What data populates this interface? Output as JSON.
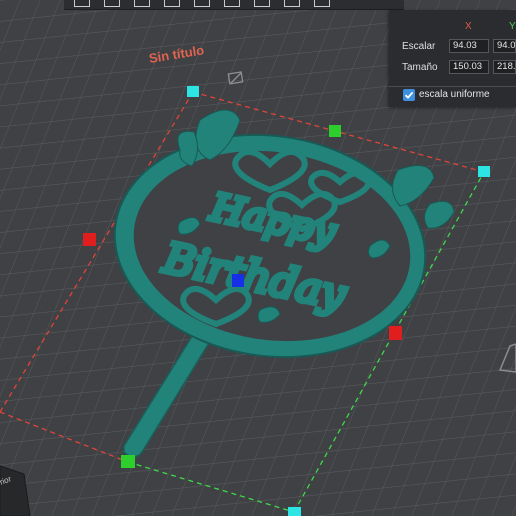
{
  "scene": {
    "title": "Sin título",
    "topper_text": [
      "Happy",
      "Birthday"
    ],
    "colors": {
      "grid_background": "#3f4144",
      "grid_line": "#575a5d",
      "model": "#22837b",
      "model_shadow": "#1a5f5a",
      "bbox_red": "#e0443a",
      "bbox_green": "#3fd94a",
      "handle_red": "#e01e1e",
      "handle_green": "#2ccf2c",
      "handle_blue": "#1630e8",
      "handle_cyan": "#2ee5e5",
      "title_color": "#e0644f"
    }
  },
  "scale_panel": {
    "axis_x": "X",
    "axis_y": "Y",
    "scale_label": "Escalar",
    "scale_x": "94.03",
    "scale_y": "94.0",
    "size_label": "Tamaño",
    "size_x": "150.03",
    "size_y": "218.",
    "uniform_label": "escala uniforme",
    "uniform_checked": true
  },
  "corner": {
    "label": "rior"
  }
}
